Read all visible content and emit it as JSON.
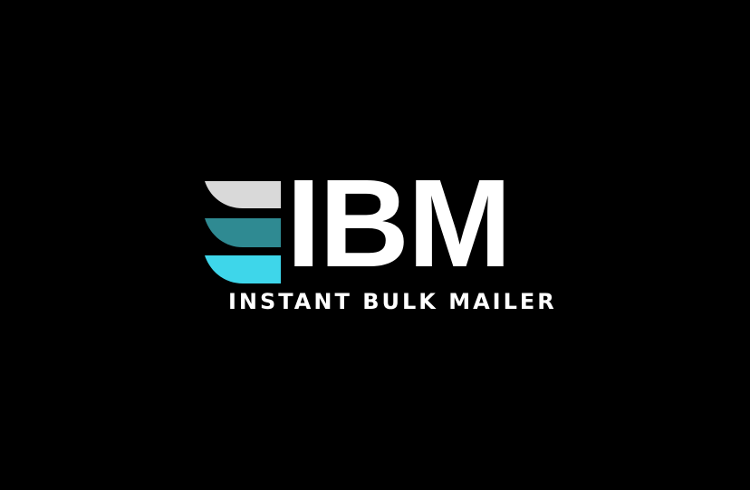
{
  "logo": {
    "wordmark": "IBM",
    "tagline": "INSTANT BULK MAILER",
    "icon": "stacked-stripes-logo-icon"
  },
  "colors": {
    "background": "#000000",
    "text": "#ffffff",
    "stripe_top": "#d9d9d9",
    "stripe_middle": "#2f8a92",
    "stripe_bottom": "#3ed6ea"
  }
}
